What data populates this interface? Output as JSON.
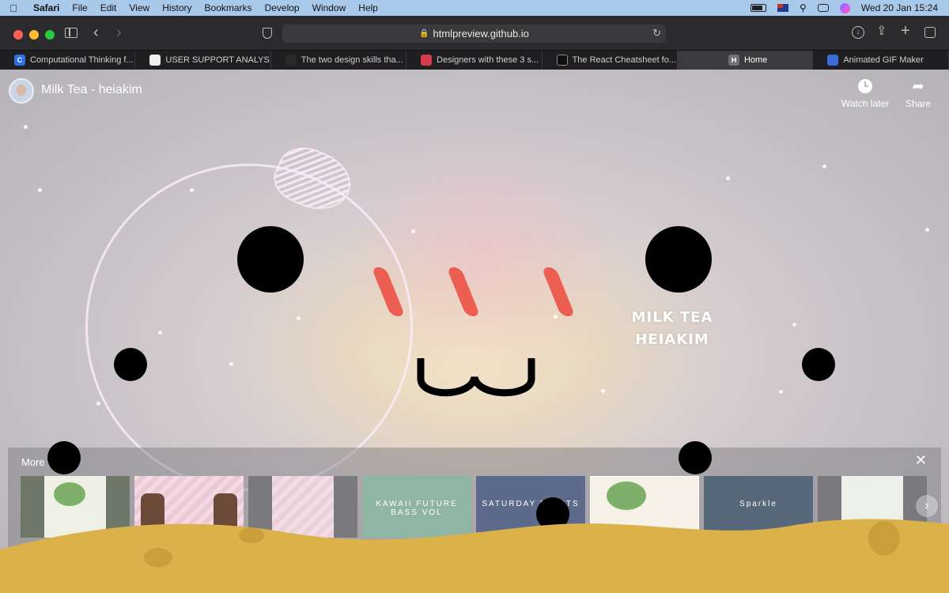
{
  "menubar": {
    "apple": "",
    "app_name": "Safari",
    "items": [
      "File",
      "Edit",
      "View",
      "History",
      "Bookmarks",
      "Develop",
      "Window",
      "Help"
    ],
    "datetime": "Wed 20 Jan  15:24"
  },
  "toolbar": {
    "url": "htmlpreview.github.io"
  },
  "tabs": [
    {
      "label": "Computational Thinking f...",
      "favicon": "C",
      "color": "#2f6ee2"
    },
    {
      "label": "USER SUPPORT ANALYS...",
      "favicon": "",
      "color": "#eeeeee"
    },
    {
      "label": "The two design skills tha...",
      "favicon": "",
      "color": "#2a2a2a"
    },
    {
      "label": "Designers with these 3 s...",
      "favicon": "",
      "color": "#d63a4b"
    },
    {
      "label": "The React Cheatsheet fo...",
      "favicon": "",
      "color": "#101010"
    },
    {
      "label": "Home",
      "favicon": "H",
      "color": "#6f6f73"
    },
    {
      "label": "Animated GIF Maker",
      "favicon": "",
      "color": "#3b6bd6"
    }
  ],
  "video": {
    "title": "Milk Tea - heiakim",
    "watch_later": "Watch later",
    "share": "Share",
    "overlay_line1": "MILK TEA",
    "overlay_line2": "HEIAKIM"
  },
  "more_videos": {
    "label": "More v",
    "close_icon": "close-icon",
    "thumbnails": [
      {
        "label": "",
        "bg": "#eef0e6"
      },
      {
        "label": "",
        "bg": "#f3d9e2"
      },
      {
        "label": "",
        "bg": "#f2dde4"
      },
      {
        "label": "KAWAII FUTURE BASS VOL",
        "bg": "#8fb6a5"
      },
      {
        "label": "SATURDAY NIGHTS",
        "bg": "#5c6a8c"
      },
      {
        "label": "",
        "bg": "#f5f1e6"
      },
      {
        "label": "Sparkle",
        "bg": "#566879"
      },
      {
        "label": "",
        "bg": "#eef0ea"
      }
    ]
  },
  "colors": {
    "cheek": "#ec5e52",
    "sand": "#dbb24a"
  }
}
